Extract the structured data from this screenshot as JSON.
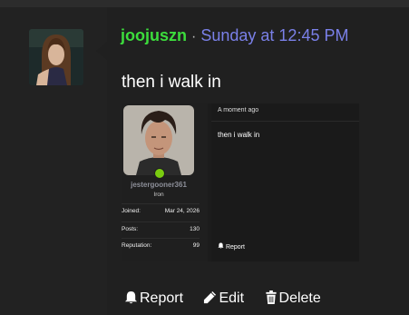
{
  "post": {
    "username": "joojuszn",
    "separator": "·",
    "timestamp": "Sunday at 12:45 PM",
    "message": "then i walk in"
  },
  "embedded_screenshot": {
    "username": "jestergooner361",
    "rank": "Iron",
    "status": "online",
    "stats": [
      {
        "label": "Joined:",
        "value": "Mar 24, 2026"
      },
      {
        "label": "Posts:",
        "value": "130"
      },
      {
        "label": "Reputation:",
        "value": "99"
      }
    ],
    "time": "A moment ago",
    "message": "then i walk in",
    "report_label": "Report"
  },
  "actions": {
    "report_label": "Report",
    "edit_label": "Edit",
    "delete_label": "Delete"
  },
  "colors": {
    "username": "#3cdc3c",
    "timestamp": "#7a80e8",
    "status_online": "#7acc10"
  }
}
